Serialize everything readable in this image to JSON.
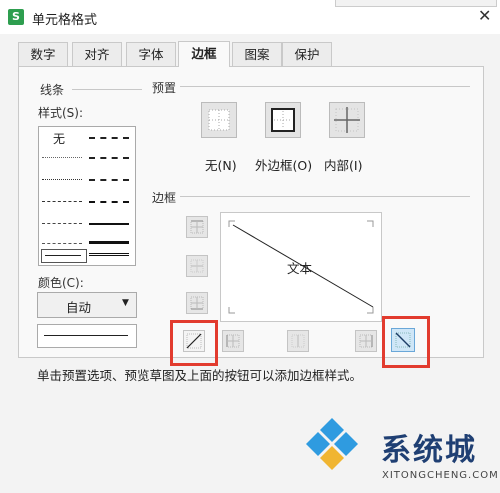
{
  "window": {
    "icon_letter": "S",
    "title": "单元格格式",
    "close_glyph": "✕"
  },
  "tabs": [
    {
      "label": "数字",
      "active": false
    },
    {
      "label": "对齐",
      "active": false
    },
    {
      "label": "字体",
      "active": false
    },
    {
      "label": "边框",
      "active": true
    },
    {
      "label": "图案",
      "active": false
    },
    {
      "label": "保护",
      "active": false
    }
  ],
  "line_section": {
    "group_label": "线条",
    "style_label": "样式(S):",
    "none_label": "无",
    "color_label": "颜色(C):",
    "color_value": "自动",
    "dropdown_arrow": "▼"
  },
  "presets": {
    "group_label": "预置",
    "items": [
      {
        "label": "无(N)"
      },
      {
        "label": "外边框(O)"
      },
      {
        "label": "内部(I)"
      }
    ]
  },
  "border": {
    "group_label": "边框",
    "preview_text": "文本"
  },
  "hint": "单击预置选项、预览草图及上面的按钮可以添加边框样式。",
  "watermark": {
    "brand": "系统城",
    "url": "XITONGCHENG.COM"
  },
  "colors": {
    "highlight_red": "#e23b2e",
    "brand_blue": "#1f3f73",
    "diamond_blue": "#2f9be0"
  }
}
